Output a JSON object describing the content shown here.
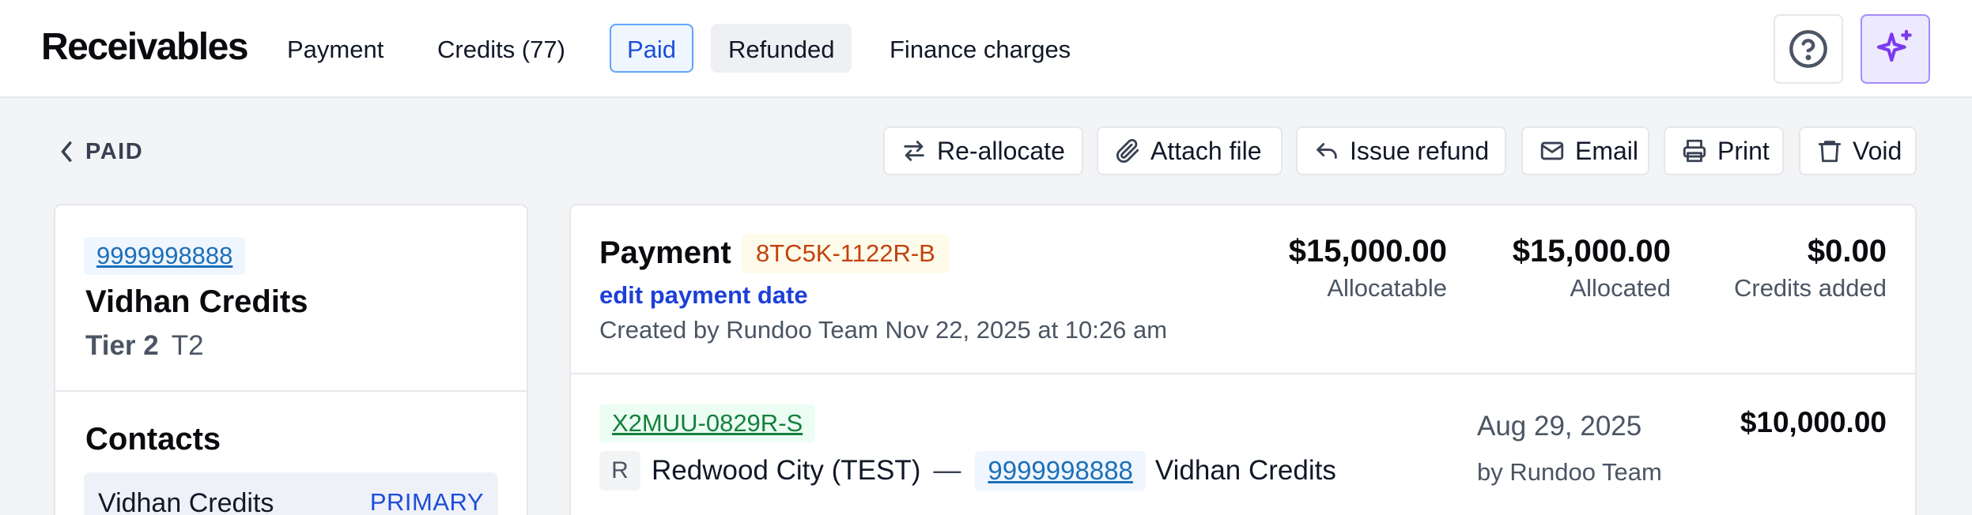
{
  "header": {
    "title": "Receivables",
    "tabs": [
      {
        "label": "Payment"
      },
      {
        "label": "Credits (77)"
      },
      {
        "label": "Paid"
      },
      {
        "label": "Refunded"
      },
      {
        "label": "Finance charges"
      }
    ],
    "help_icon": "question-circle-icon",
    "ai_icon": "sparkles-icon"
  },
  "subheader": {
    "back_label": "PAID",
    "actions": [
      {
        "label": "Re-allocate",
        "icon": "swap-arrows-icon"
      },
      {
        "label": "Attach file",
        "icon": "paperclip-icon"
      },
      {
        "label": "Issue refund",
        "icon": "reply-arrow-icon"
      },
      {
        "label": "Email",
        "icon": "envelope-icon"
      },
      {
        "label": "Print",
        "icon": "printer-icon"
      },
      {
        "label": "Void",
        "icon": "trash-icon"
      }
    ]
  },
  "customer": {
    "id": "9999998888",
    "name": "Vidhan Credits",
    "tier": "Tier 2",
    "tier_code": "T2",
    "contacts_title": "Contacts",
    "contacts": [
      {
        "name": "Vidhan Credits",
        "badge": "PRIMARY"
      }
    ]
  },
  "payment": {
    "label": "Payment",
    "reference": "8TC5K-1122R-B",
    "edit_link": "edit payment date",
    "created": "Created by Rundoo Team Nov 22, 2025 at 10:26 am",
    "stats": [
      {
        "amount": "$15,000.00",
        "label": "Allocatable"
      },
      {
        "amount": "$15,000.00",
        "label": "Allocated"
      },
      {
        "amount": "$0.00",
        "label": "Credits added"
      }
    ],
    "allocations": [
      {
        "reference": "X2MUU-0829R-S",
        "location_badge": "R",
        "location": "Redwood City (TEST)",
        "separator": "—",
        "customer_id": "9999998888",
        "customer_name": "Vidhan Credits",
        "date": "Aug 29, 2025",
        "by": "by Rundoo Team",
        "amount": "$10,000.00"
      }
    ]
  },
  "colors": {
    "accent": "#1d4ed8",
    "link": "#1d6fb8",
    "reference_orange": "#c2410c",
    "reference_green": "#15803d",
    "ai_purple": "#7c3aed",
    "page_bg": "#f3f4f6"
  }
}
